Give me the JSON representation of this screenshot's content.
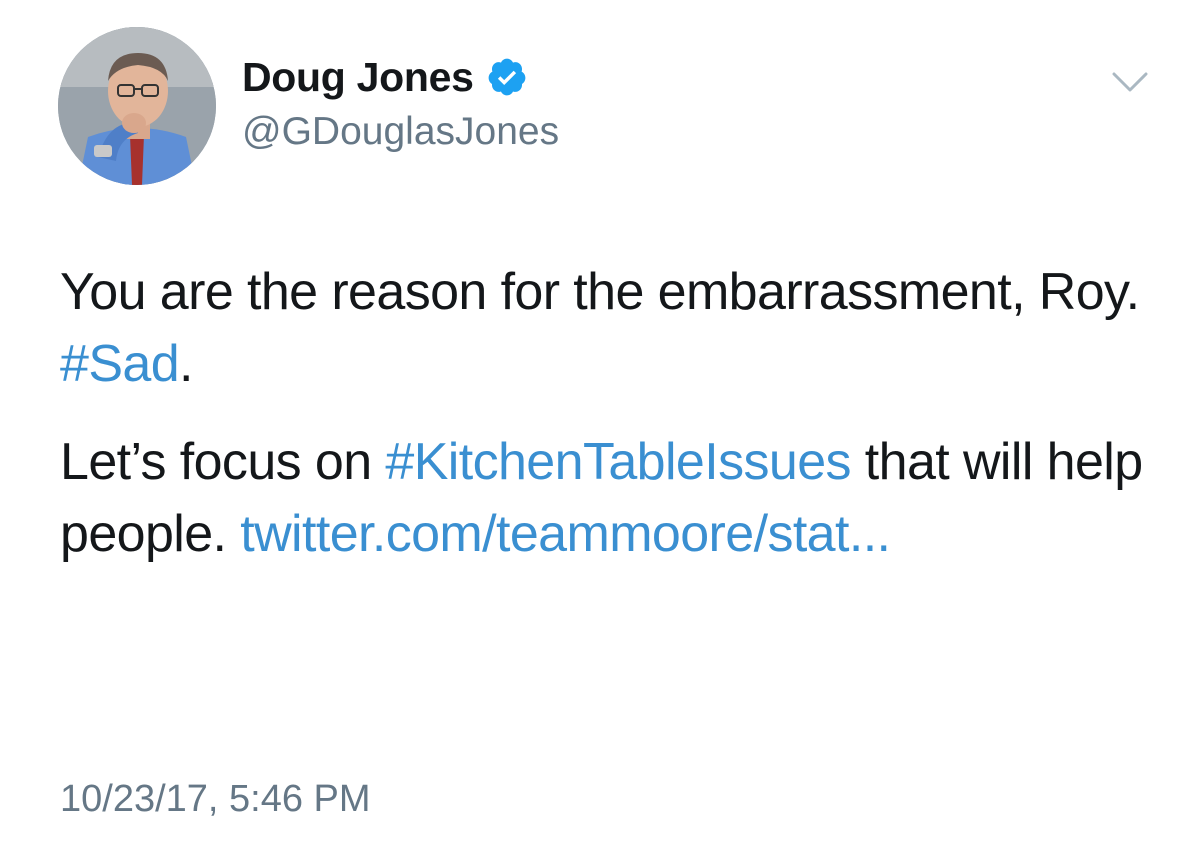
{
  "author": {
    "display_name": "Doug Jones",
    "handle": "@GDouglasJones",
    "verified": true,
    "avatar_icon": "profile-photo"
  },
  "menu": {
    "icon": "chevron-down-icon"
  },
  "tweet": {
    "paragraph1": {
      "text_a": "You are the reason for the embarrassment, Roy. ",
      "hashtag": "#Sad",
      "text_b": "."
    },
    "paragraph2": {
      "text_a": "Let’s focus on ",
      "hashtag": "#KitchenTableIssues",
      "text_b": " that will help people. ",
      "url": "twitter.com/teammoore/stat..."
    },
    "timestamp": "10/23/17, 5:46 PM"
  },
  "colors": {
    "link": "#3a8fd1",
    "verified_badge": "#1da1f2",
    "secondary_text": "#657786",
    "primary_text": "#14171a"
  }
}
